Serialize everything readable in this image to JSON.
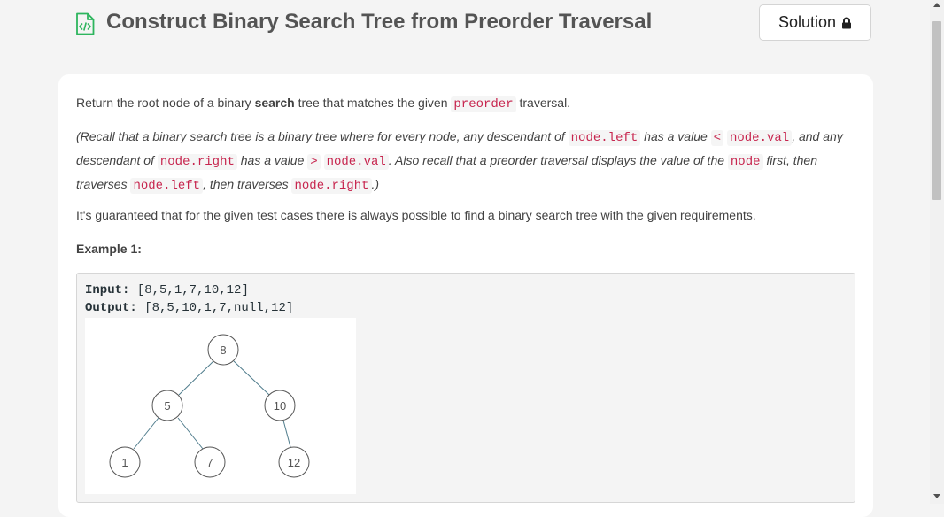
{
  "header": {
    "title": "Construct Binary Search Tree from Preorder Traversal",
    "solution_label": "Solution",
    "accent": "#2db55d"
  },
  "description": {
    "p1": {
      "before": "Return the root node of a binary ",
      "bold": "search",
      "middle": " tree that matches the given ",
      "code": "preorder",
      "after": " traversal."
    },
    "p2": {
      "t1": "(Recall that a binary search tree is a binary tree where for every ",
      "node_word": "node",
      "t2": ", any descendant of ",
      "c1": "node.left",
      "t3": " has a value ",
      "c2": "<",
      "t4": " ",
      "c3": "node.val",
      "t5": ", and any descendant of ",
      "c4": "node.right",
      "t6": " has a value ",
      "c5": ">",
      "t7": " ",
      "c6": "node.val",
      "t8": ".  Also recall that a preorder traversal displays the value of the ",
      "c7": "node",
      "t9": " first, then traverses ",
      "c8": "node.left",
      "t10": ", then traverses ",
      "c9": "node.right",
      "t11": ".)"
    },
    "p3": "It's guaranteed that for the given test cases there is always possible to find a binary search tree with the given requirements.",
    "example_title": "Example 1:"
  },
  "example": {
    "input_label": "Input:",
    "input_value": " [8,5,1,7,10,12]",
    "output_label": "Output:",
    "output_value": " [8,5,10,1,7,null,12]",
    "tree_nodes": {
      "root": "8",
      "left": "5",
      "right": "10",
      "left_left": "1",
      "left_right": "7",
      "right_right": "12"
    }
  },
  "colors": {
    "code_text": "#c7254e",
    "code_bg": "#f5f5f5",
    "card_bg": "#ffffff",
    "page_bg": "#f4f4f4"
  },
  "icons": {
    "title_icon": "code-file-icon",
    "solution_icon": "lock-icon"
  }
}
